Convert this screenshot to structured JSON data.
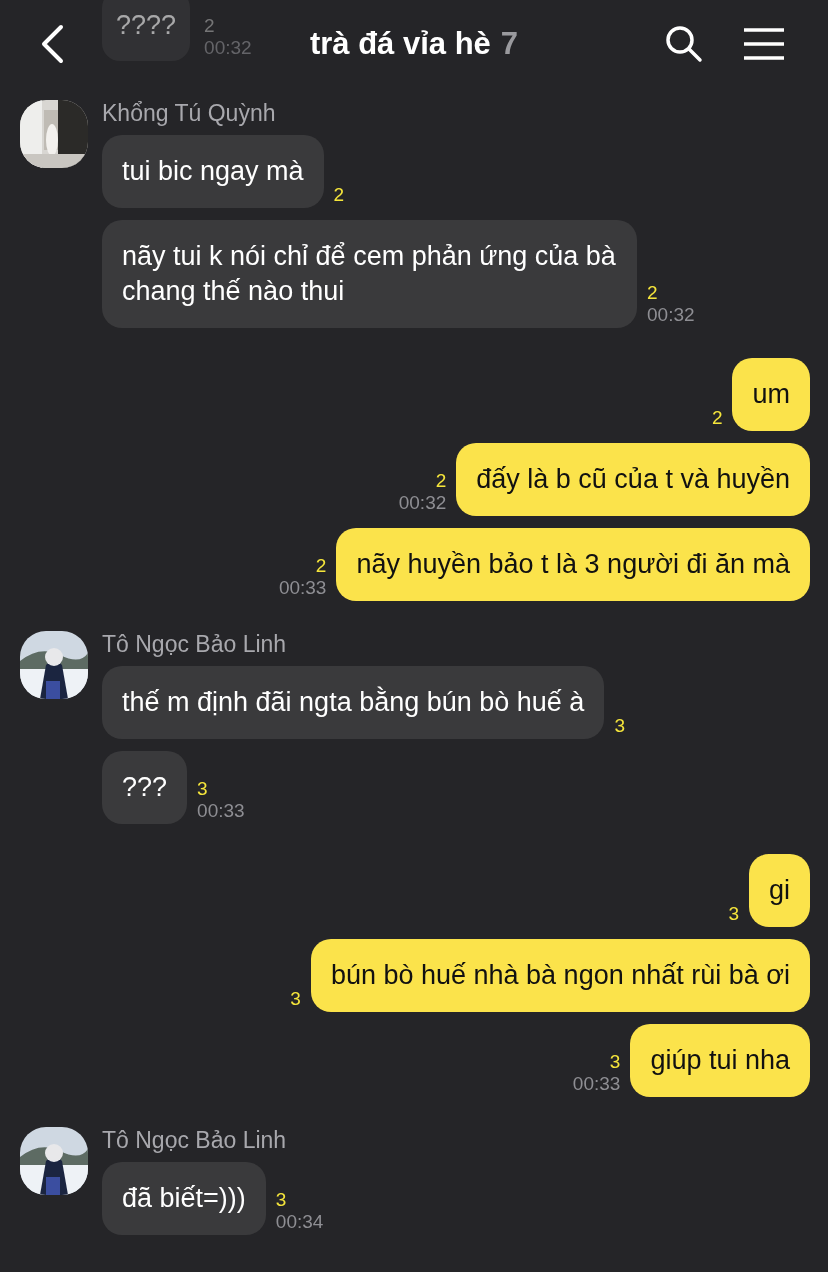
{
  "header": {
    "title": "trà đá vỉa hè",
    "member_count": "7"
  },
  "hidden_message": {
    "text": "????",
    "unread": "2",
    "time": "00:32"
  },
  "groups": [
    {
      "kind": "received",
      "sender": "Khổng Tú Quỳnh",
      "messages": [
        {
          "text": "tui bic ngay mà",
          "unread": "2"
        },
        {
          "text": "nãy tui k nói chỉ để cem phản ứng của bà chang thế nào thui",
          "unread": "2",
          "time": "00:32"
        }
      ]
    },
    {
      "kind": "sent",
      "messages": [
        {
          "text": "um",
          "unread": "2"
        },
        {
          "text": "đấy là b cũ của t và huyền",
          "unread": "2",
          "time": "00:32"
        },
        {
          "text": "nãy huyền bảo t là 3 người đi ăn mà",
          "unread": "2",
          "time": "00:33"
        }
      ]
    },
    {
      "kind": "received",
      "sender": "Tô Ngọc Bảo Linh",
      "messages": [
        {
          "text": "thế m định đãi ngta bằng bún bò huế à",
          "unread": "3"
        },
        {
          "text": "???",
          "unread": "3",
          "time": "00:33"
        }
      ]
    },
    {
      "kind": "sent",
      "messages": [
        {
          "text": "gi",
          "unread": "3"
        },
        {
          "text": "bún bò huế nhà bà ngon nhất rùi bà ơi",
          "unread": "3"
        },
        {
          "text": "giúp tui nha",
          "unread": "3",
          "time": "00:33"
        }
      ]
    },
    {
      "kind": "received",
      "sender": "Tô Ngọc Bảo Linh",
      "messages": [
        {
          "text": "đã biết=)))",
          "unread": "3",
          "time": "00:34"
        }
      ]
    }
  ]
}
